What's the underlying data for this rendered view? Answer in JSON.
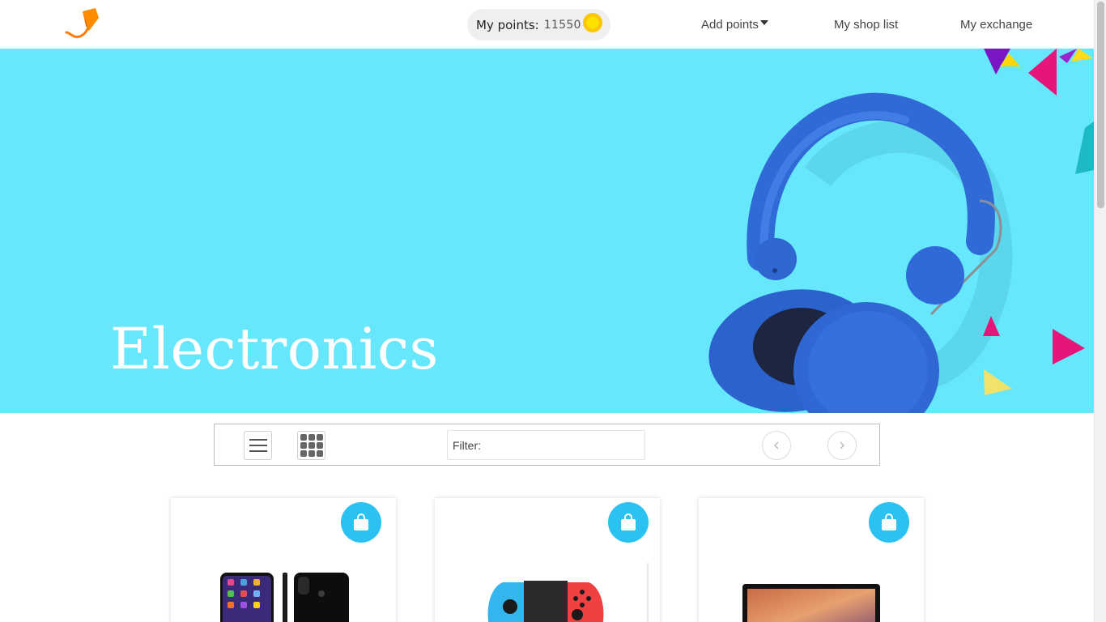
{
  "header": {
    "logo_icon": "brand-logo-icon",
    "points_label": "My points:",
    "points_value": "11550",
    "coin_icon": "coin-icon",
    "nav": {
      "add_points": "Add points",
      "shop_list": "My shop list",
      "exchange": "My exchange"
    }
  },
  "banner": {
    "title": "Electronics",
    "background_color": "#67e7fc",
    "image": "headphones-image"
  },
  "toolbar": {
    "list_view_icon": "list-view-icon",
    "grid_view_icon": "grid-view-icon",
    "filter_label": "Filter:",
    "filter_value": "",
    "prev_icon": "chevron-left-icon",
    "next_icon": "chevron-right-icon"
  },
  "products": [
    {
      "image": "smartphone-image",
      "action_icon": "shopping-bag-icon"
    },
    {
      "image": "game-console-controller-image",
      "action_icon": "shopping-bag-icon"
    },
    {
      "image": "laptop-image",
      "action_icon": "shopping-bag-icon"
    }
  ],
  "colors": {
    "accent": "#2bc1f0",
    "logo": "#ff7a00",
    "coin": "#ffd500"
  }
}
